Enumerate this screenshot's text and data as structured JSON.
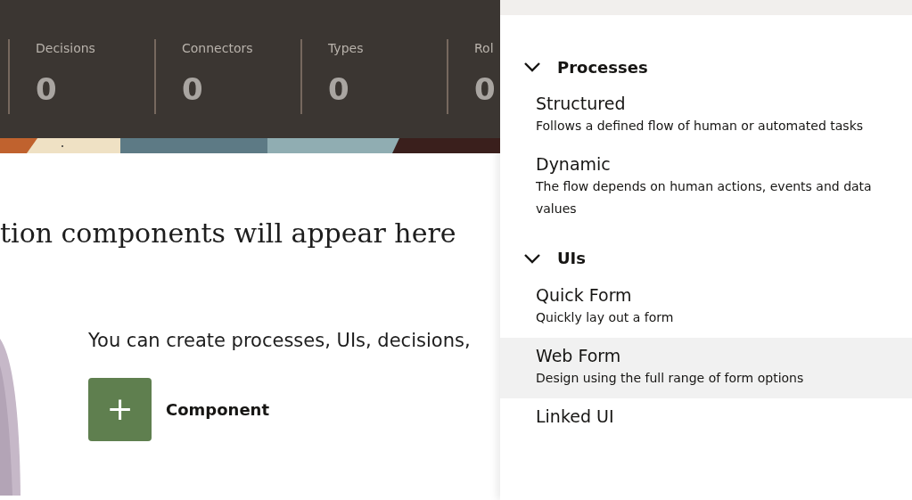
{
  "stats": [
    {
      "label": "Decisions",
      "value": "0"
    },
    {
      "label": "Connectors",
      "value": "0"
    },
    {
      "label": "Types",
      "value": "0"
    },
    {
      "label": "Rol",
      "value": "0"
    }
  ],
  "empty_state": {
    "heading": "tion components will appear here",
    "message": "You can create processes, UIs, decisions,",
    "button_icon": "+",
    "button_label": "Component"
  },
  "menu": {
    "sections": [
      {
        "title": "Processes",
        "expanded": true,
        "items": [
          {
            "title": "Structured",
            "description": "Follows a defined flow of human or automated tasks",
            "selected": false
          },
          {
            "title": "Dynamic",
            "description": "The flow depends on human actions, events and data values",
            "selected": false
          }
        ]
      },
      {
        "title": "UIs",
        "expanded": true,
        "items": [
          {
            "title": "Quick Form",
            "description": "Quickly lay out a form",
            "selected": false
          },
          {
            "title": "Web Form",
            "description": "Design using the full range of form options",
            "selected": true
          },
          {
            "title": "Linked UI",
            "selected": false
          }
        ]
      }
    ]
  }
}
